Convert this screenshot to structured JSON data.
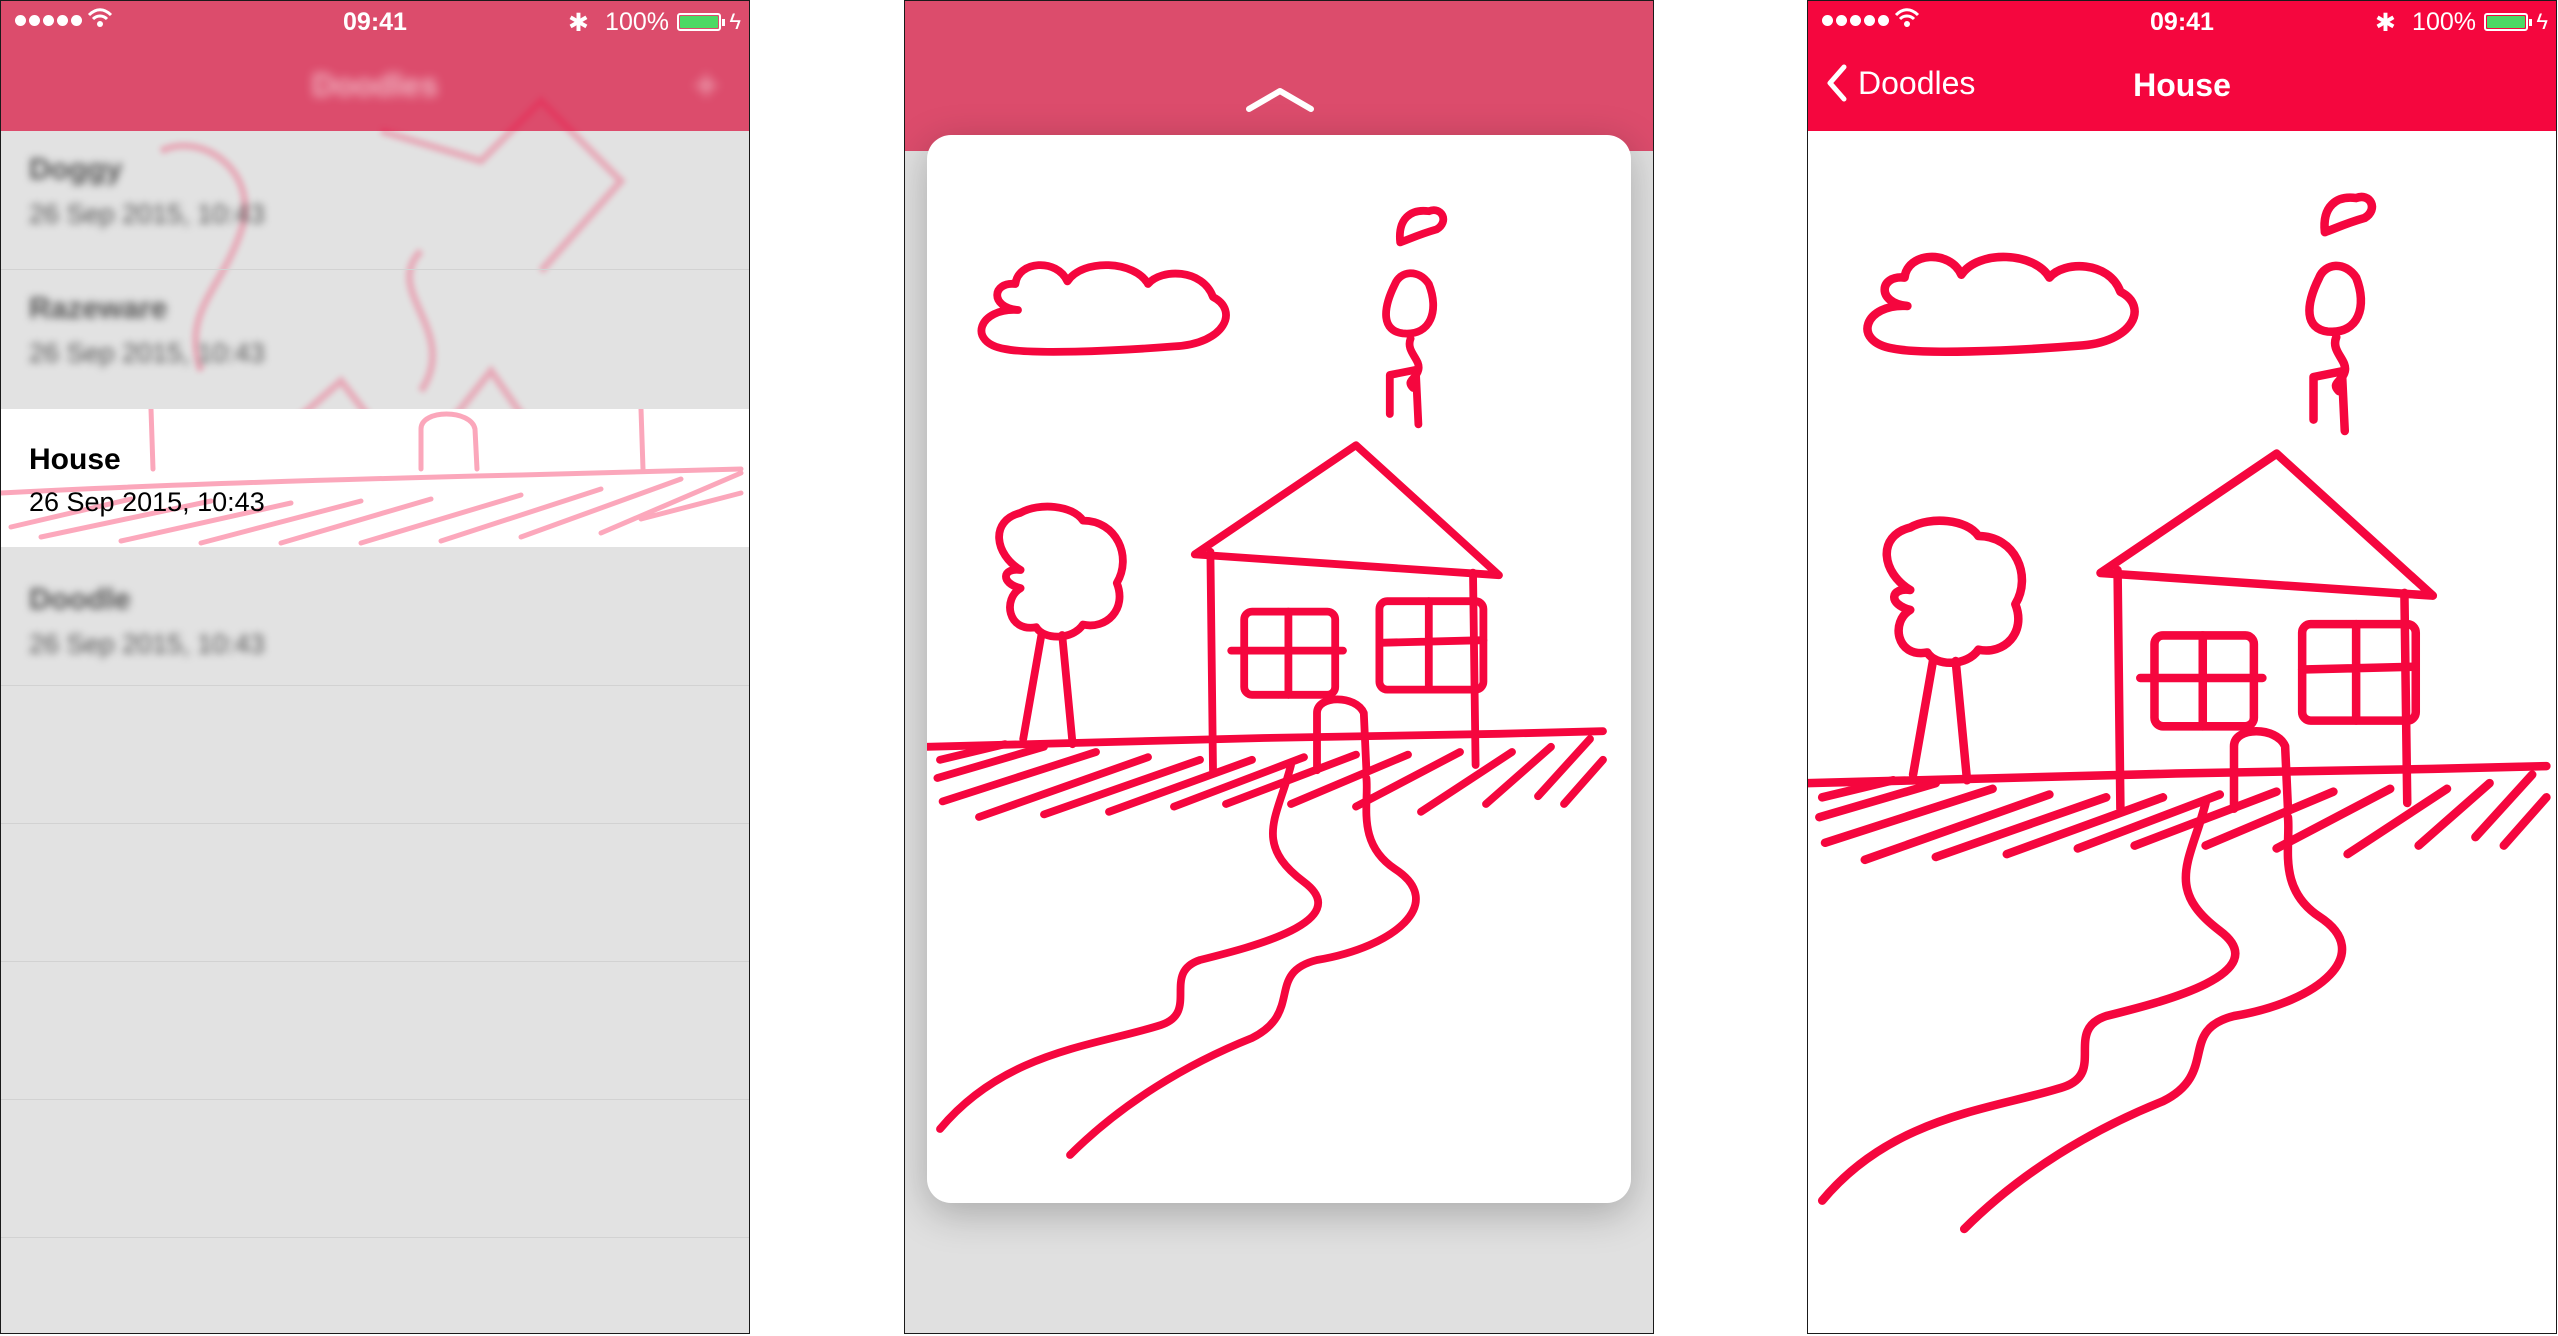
{
  "status_bar": {
    "time": "09:41",
    "battery_text": "100%",
    "signal_icon": "signal-dots-icon",
    "wifi_icon": "wifi-icon",
    "bluetooth_icon": "bluetooth-icon",
    "battery_icon": "battery-icon",
    "charging_icon": "charging-bolt-icon"
  },
  "colors": {
    "accent": "#f5063e",
    "accent_dimmed": "#dc4c6c",
    "list_background": "#e2e2e2",
    "battery_fill": "#4cd964"
  },
  "list_screen": {
    "nav_title": "Doodles",
    "add_icon": "plus-icon",
    "rows": [
      {
        "name": "Doggy",
        "date": "26 Sep 2015, 10:43"
      },
      {
        "name": "Razeware",
        "date": "26 Sep 2015, 10:43"
      },
      {
        "name": "House",
        "date": "26 Sep 2015, 10:43"
      },
      {
        "name": "Doodle",
        "date": "26 Sep 2015, 10:43"
      }
    ]
  },
  "peek_screen": {
    "chevron_icon": "chevron-up-icon"
  },
  "detail_screen": {
    "back_label": "Doodles",
    "back_icon": "chevron-left-icon",
    "title": "House"
  }
}
